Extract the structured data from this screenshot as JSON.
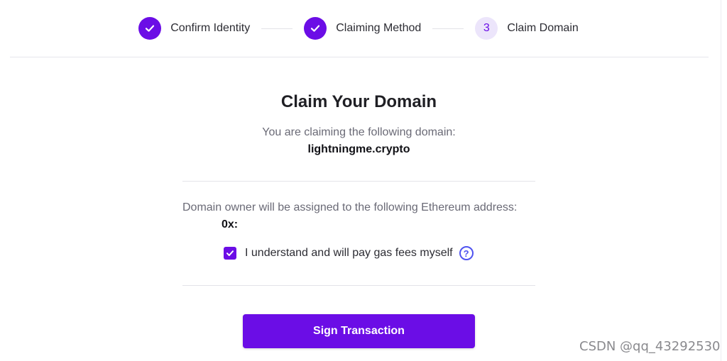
{
  "stepper": {
    "steps": [
      {
        "label": "Confirm Identity",
        "status": "completed"
      },
      {
        "label": "Claiming Method",
        "status": "completed"
      },
      {
        "label": "Claim Domain",
        "status": "current",
        "number": "3"
      }
    ]
  },
  "main": {
    "title": "Claim Your Domain",
    "subtitle": "You are claiming the following domain:",
    "domain": "lightningme.crypto",
    "owner_text": "Domain owner will be assigned to the following Ethereum address:",
    "address": "0x:",
    "gas_checkbox": {
      "label": "I understand and will pay gas fees myself",
      "checked": true
    },
    "sign_button_label": "Sign Transaction"
  },
  "watermark": "CSDN @qq_43292530",
  "colors": {
    "accent": "#6b0de6",
    "accent_light": "#ece5fb",
    "help_icon": "#4f53f0",
    "muted_text": "#6a6a76"
  },
  "icons": {
    "completed_step": "check-icon",
    "help": "question-circle-icon"
  }
}
